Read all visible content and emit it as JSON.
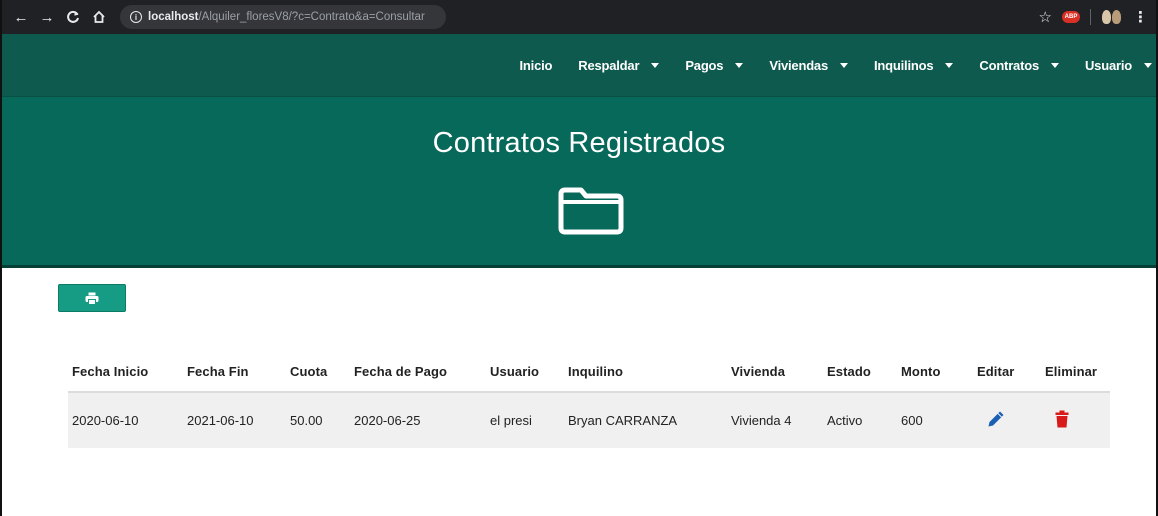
{
  "browser": {
    "url_host": "localhost",
    "url_path": "/Alquiler_floresV8/?c=Contrato&a=Consultar",
    "extension_badge": "ABP"
  },
  "navbar": {
    "items": [
      {
        "label": "Inicio",
        "dropdown": false
      },
      {
        "label": "Respaldar",
        "dropdown": true
      },
      {
        "label": "Pagos",
        "dropdown": true
      },
      {
        "label": "Viviendas",
        "dropdown": true
      },
      {
        "label": "Inquilinos",
        "dropdown": true
      },
      {
        "label": "Contratos",
        "dropdown": true
      },
      {
        "label": "Usuario",
        "dropdown": true
      }
    ]
  },
  "banner": {
    "title": "Contratos Registrados",
    "icon": "folder-icon"
  },
  "toolbar": {
    "print_icon": "print-icon"
  },
  "table": {
    "headers": {
      "fecha_inicio": "Fecha Inicio",
      "fecha_fin": "Fecha Fin",
      "cuota": "Cuota",
      "fecha_pago": "Fecha de Pago",
      "usuario": "Usuario",
      "inquilino": "Inquilino",
      "vivienda": "Vivienda",
      "estado": "Estado",
      "monto": "Monto",
      "editar": "Editar",
      "eliminar": "Eliminar"
    },
    "rows": [
      {
        "fecha_inicio": "2020-06-10",
        "fecha_fin": "2021-06-10",
        "cuota": "50.00",
        "fecha_pago": "2020-06-25",
        "usuario": "el presi",
        "inquilino": "Bryan CARRANZA",
        "vivienda": "Vivienda 4",
        "estado": "Activo",
        "monto": "600",
        "edit_icon": "pencil-icon",
        "delete_icon": "trash-icon"
      }
    ]
  },
  "colors": {
    "navbar": "#0e5a4e",
    "banner": "#07695a",
    "print_button": "#169c84",
    "edit_icon": "#1a5fb4",
    "delete_icon": "#d91a1a"
  }
}
